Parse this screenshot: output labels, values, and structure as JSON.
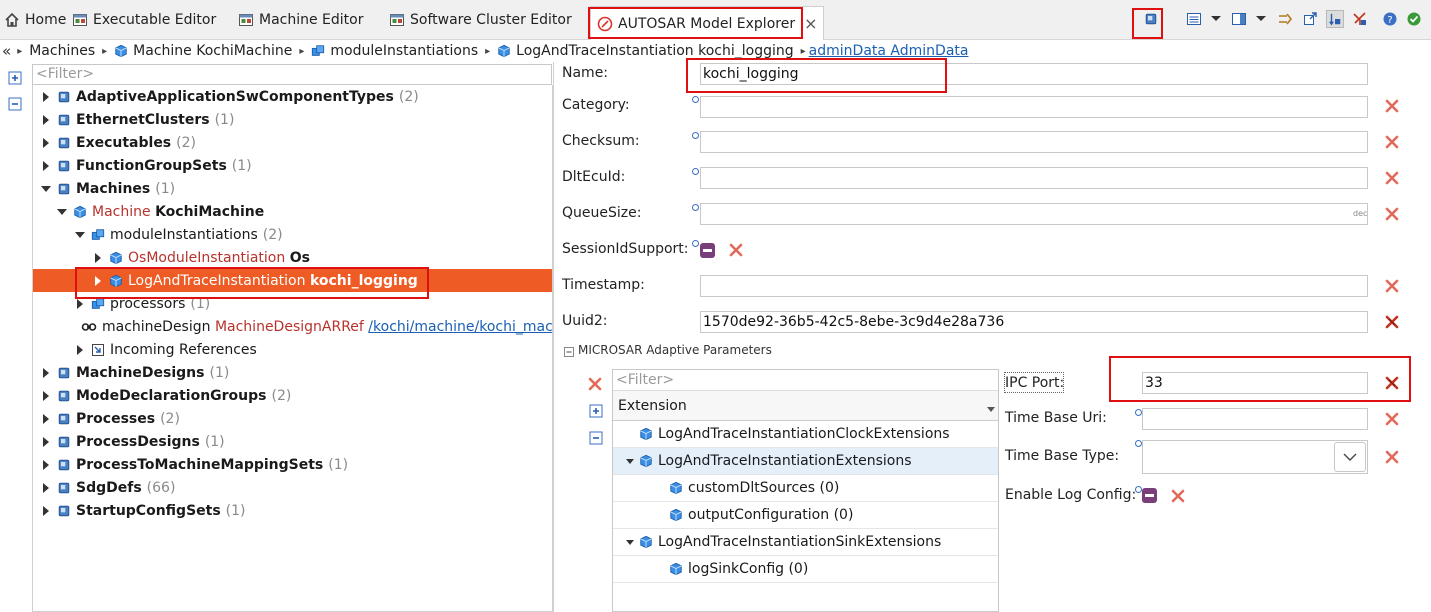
{
  "tabs": [
    {
      "label": "Home",
      "icon": "home-icon"
    },
    {
      "label": "Executable Editor",
      "icon": "editor-icon"
    },
    {
      "label": "Machine Editor",
      "icon": "editor-icon"
    },
    {
      "label": "Software Cluster Editor",
      "icon": "editor-icon"
    },
    {
      "label": "AUTOSAR Model Explorer",
      "icon": "autosar-icon",
      "close": "×"
    }
  ],
  "breadcrumb": [
    {
      "label": "Machines"
    },
    {
      "label": "Machine KochiMachine"
    },
    {
      "label": "moduleInstantiations"
    },
    {
      "label": "LogAndTraceInstantiation kochi_logging"
    },
    {
      "label": "adminData AdminData"
    }
  ],
  "filter_placeholder": "<Filter>",
  "tree": [
    {
      "name": "AdaptiveApplicationSwComponentTypes",
      "count": "(2)"
    },
    {
      "name": "EthernetClusters",
      "count": "(1)"
    },
    {
      "name": "Executables",
      "count": "(2)"
    },
    {
      "name": "FunctionGroupSets",
      "count": "(1)"
    },
    {
      "name": "Machines",
      "count": "(1)"
    },
    {
      "type": "Machine",
      "name": "KochiMachine"
    },
    {
      "name": "moduleInstantiations",
      "count": "(2)"
    },
    {
      "type": "OsModuleInstantiation",
      "name": "Os"
    },
    {
      "type": "LogAndTraceInstantiation",
      "name": "kochi_logging"
    },
    {
      "name": "processors",
      "count": "(1)"
    },
    {
      "name": "machineDesign",
      "type": "MachineDesignARRef",
      "link": "/kochi/machine/kochi_machin"
    },
    {
      "name": "Incoming References"
    },
    {
      "name": "MachineDesigns",
      "count": "(1)"
    },
    {
      "name": "ModeDeclarationGroups",
      "count": "(2)"
    },
    {
      "name": "Processes",
      "count": "(2)"
    },
    {
      "name": "ProcessDesigns",
      "count": "(1)"
    },
    {
      "name": "ProcessToMachineMappingSets",
      "count": "(1)"
    },
    {
      "name": "SdgDefs",
      "count": "(66)"
    },
    {
      "name": "StartupConfigSets",
      "count": "(1)"
    }
  ],
  "form": {
    "name": {
      "label": "Name:",
      "value": "kochi_logging"
    },
    "category": {
      "label": "Category:",
      "value": ""
    },
    "checksum": {
      "label": "Checksum:",
      "value": ""
    },
    "dlt_ecu_id": {
      "label": "DltEcuId:",
      "value": ""
    },
    "queue_size": {
      "label": "QueueSize:",
      "value": "",
      "suffix": "dec"
    },
    "session_id_support": {
      "label": "SessionIdSupport:"
    },
    "timestamp": {
      "label": "Timestamp:",
      "value": ""
    },
    "uuid2": {
      "label": "Uuid2:",
      "value": "1570de92-36b5-42c5-8ebe-3c9d4e28a736"
    }
  },
  "section_title": "MICROSAR Adaptive Parameters",
  "extension_table": {
    "header": "Extension",
    "rows": [
      {
        "label": "LogAndTraceInstantiationClockExtensions"
      },
      {
        "label": "LogAndTraceInstantiationExtensions"
      },
      {
        "label": "customDltSources (0)"
      },
      {
        "label": "outputConfiguration (0)"
      },
      {
        "label": "LogAndTraceInstantiationSinkExtensions"
      },
      {
        "label": "logSinkConfig (0)"
      }
    ]
  },
  "ext_form": {
    "ipc_port": {
      "label": "IPC Port:",
      "value": "33"
    },
    "time_base_uri": {
      "label": "Time Base Uri:",
      "value": ""
    },
    "time_base_type": {
      "label": "Time Base Type:",
      "value": ""
    },
    "enable_log_config": {
      "label": "Enable Log Config:"
    }
  },
  "colors": {
    "selection": "#ee5b24",
    "highlight": "#e01010",
    "link": "#1a5fb4",
    "package_blue": "#2f6db5",
    "delete_red": "#d9534f"
  }
}
